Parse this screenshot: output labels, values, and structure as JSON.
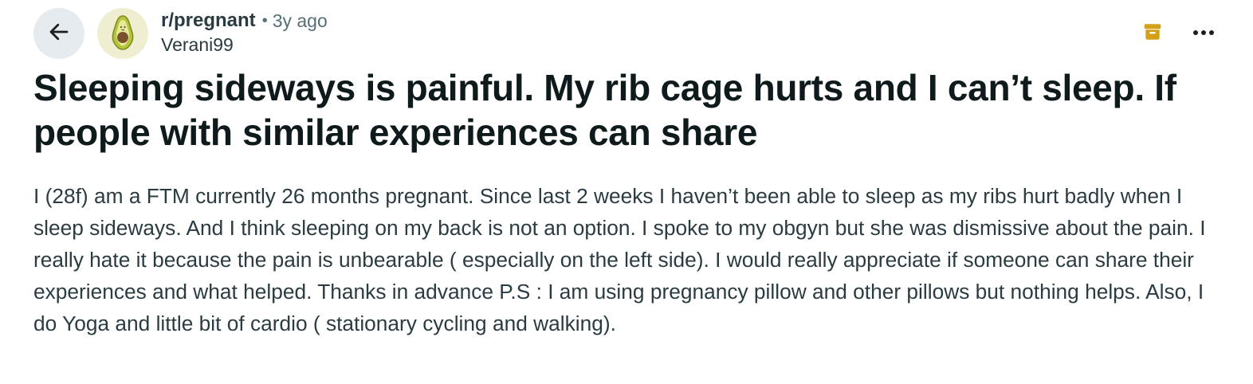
{
  "header": {
    "subreddit": "r/pregnant",
    "separator": "•",
    "time_ago": "3y ago",
    "author": "Verani99",
    "icons": {
      "back": "arrow-left-icon",
      "avatar": "avocado-icon",
      "archive": "archive-icon",
      "more": "more-options-icon"
    },
    "colors": {
      "back_button_bg": "#e5ebee",
      "archive_icon": "#d4a017",
      "avatar_bg": "#efeed0"
    }
  },
  "post": {
    "title": "Sleeping sideways is painful. My rib cage hurts and I can’t sleep. If people with similar experiences can share",
    "body": "I (28f) am a FTM currently 26 months pregnant. Since last 2 weeks I haven’t been able to sleep as my ribs hurt badly when I sleep sideways. And I think sleeping on my back is not an option. I spoke to my obgyn but she was dismissive about the pain. I really hate it because the pain is unbearable ( especially on the left side). I would really appreciate if someone can share their experiences and what helped. Thanks in advance P.S : I am using pregnancy pillow and other pillows but nothing helps. Also, I do Yoga and little bit of cardio ( stationary cycling and walking)."
  }
}
